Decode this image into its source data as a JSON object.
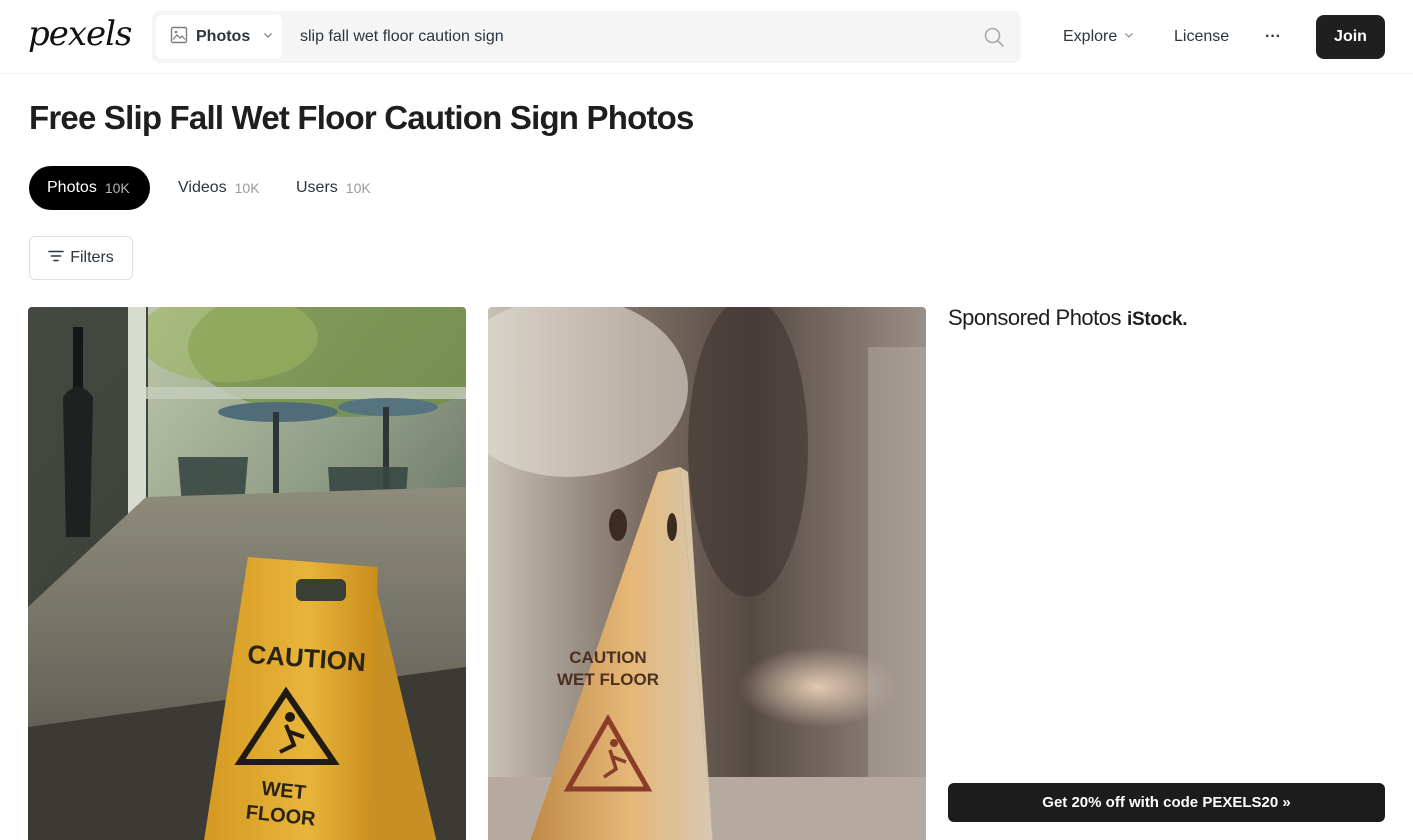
{
  "header": {
    "logo": "pexels",
    "search": {
      "type_label": "Photos",
      "query": "slip fall wet floor caution sign"
    },
    "nav": {
      "explore": "Explore",
      "license": "License",
      "more": "···",
      "join": "Join"
    }
  },
  "main": {
    "title": "Free Slip Fall Wet Floor Caution Sign Photos",
    "tabs": [
      {
        "label": "Photos",
        "count": "10K",
        "active": true
      },
      {
        "label": "Videos",
        "count": "10K",
        "active": false
      },
      {
        "label": "Users",
        "count": "10K",
        "active": false
      }
    ],
    "filters_label": "Filters",
    "photos": [
      {
        "sign_text_1": "CAUTION",
        "sign_text_2": "WET",
        "sign_text_3": "FLOOR"
      },
      {
        "sign_text_1": "CAUTION",
        "sign_text_2": "WET FLOOR"
      }
    ]
  },
  "sponsored": {
    "title": "Sponsored Photos",
    "brand": "iStock.",
    "promo": "Get 20% off with code PEXELS20 »"
  },
  "colors": {
    "accent_dark": "#1f1f1f",
    "text": "#2c343e",
    "search_bg": "#f5f5f5",
    "caution_yellow": "#e0a62a"
  }
}
